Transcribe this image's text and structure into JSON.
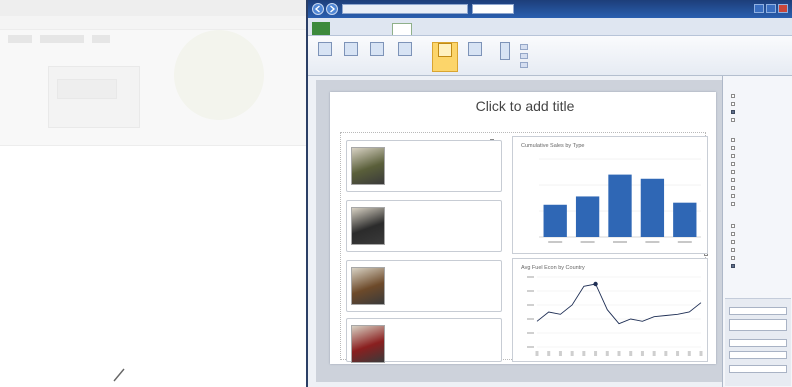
{
  "app": {
    "ribbon_tabs": [],
    "slide": {
      "title": "Click to add title",
      "cards": [
        {
          "make": "",
          "model": "",
          "price": "",
          "mpg": "",
          "color": "#5a5f3a"
        },
        {
          "make": "",
          "model": "",
          "price": "",
          "mpg": "",
          "color": "#2b2b2b"
        },
        {
          "make": "",
          "model": "",
          "price": "",
          "mpg": "",
          "color": "#6d4a2a"
        },
        {
          "make": "",
          "model": "",
          "price": "",
          "mpg": "",
          "color": "#8a1f1f"
        }
      ]
    },
    "bar_chart_title": "Cumulative Sales by Type",
    "line_chart_title": "Avg Fuel Econ by Country",
    "taskpane": {
      "title": "",
      "lower_field_value": ""
    }
  },
  "chart_data": [
    {
      "type": "bar",
      "title": "Cumulative Sales by Type",
      "values": [
        62,
        78,
        120,
        112,
        66
      ],
      "ylim": [
        0,
        150
      ],
      "categories": []
    },
    {
      "type": "line",
      "title": "Avg Fuel Econ by Country",
      "values": [
        22,
        30,
        28,
        36,
        52,
        54,
        32,
        20,
        24,
        22,
        26,
        27,
        28,
        30,
        38
      ],
      "ylim": [
        0,
        60
      ]
    }
  ],
  "colors": {
    "bar": "#2f67b5",
    "line": "#1f2f55",
    "titlebar": "#2a5fb0",
    "file_tab": "#3d8a3c",
    "selected_button": "#fcd56a"
  },
  "icons": [
    "back-icon",
    "forward-icon",
    "minimize-icon",
    "maximize-icon",
    "close-icon",
    "cursor-icon"
  ]
}
